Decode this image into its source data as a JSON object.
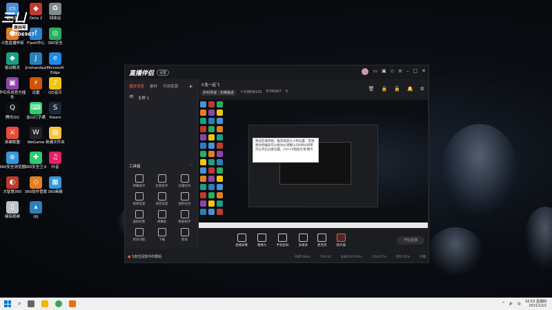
{
  "overlay_logo": {
    "text": "三ㄩ",
    "sub": "房间号",
    "number": "8706967"
  },
  "desktop_icons": [
    {
      "label": "此电脑",
      "color": "#4a90d9",
      "glyph": "▭"
    },
    {
      "label": "Dota 2",
      "color": "#c0392b",
      "glyph": "◆"
    },
    {
      "label": "回收站",
      "color": "#7f8c8d",
      "glyph": "♻"
    },
    {
      "label": "斗鱼直播伴侣",
      "color": "#e67e22",
      "glyph": "●"
    },
    {
      "label": "Flash中心",
      "color": "#2c82c9",
      "glyph": "f"
    },
    {
      "label": "360安全",
      "color": "#27ae60",
      "glyph": "◎"
    },
    {
      "label": "驱动精灵",
      "color": "#16a085",
      "glyph": "◆"
    },
    {
      "label": "jinshandazi",
      "color": "#2980b9",
      "glyph": "J"
    },
    {
      "label": "Microsoft Edge",
      "color": "#1e88e5",
      "glyph": "e"
    },
    {
      "label": "炉石传说官方插件",
      "color": "#8e44ad",
      "glyph": "▣"
    },
    {
      "label": "迅雷",
      "color": "#d35400",
      "glyph": "⚡"
    },
    {
      "label": "QQ音乐",
      "color": "#f1c40f",
      "glyph": "♪"
    },
    {
      "label": "腾讯QQ",
      "color": "#111111",
      "glyph": "Q"
    },
    {
      "label": "金山打字通",
      "color": "#2ecc71",
      "glyph": "⌨"
    },
    {
      "label": "Steam",
      "color": "#1b2838",
      "glyph": "S"
    },
    {
      "label": "英雄联盟",
      "color": "#e74c3c",
      "glyph": "⚔"
    },
    {
      "label": "WeGame",
      "color": "#222222",
      "glyph": "W"
    },
    {
      "label": "新建文件夹",
      "color": "#f5c542",
      "glyph": "▤"
    },
    {
      "label": "360安全浏览器",
      "color": "#3498db",
      "glyph": "⊕"
    },
    {
      "label": "360安全卫士",
      "color": "#2ecc71",
      "glyph": "✚"
    },
    {
      "label": "抖音",
      "color": "#e91e63",
      "glyph": "♫"
    },
    {
      "label": "大智慧365",
      "color": "#c0392b",
      "glyph": "◐"
    },
    {
      "label": "360软件管家",
      "color": "#e67e22",
      "glyph": "◇"
    },
    {
      "label": "360画报",
      "color": "#3498db",
      "glyph": "▦"
    },
    {
      "label": "鼎铝视频",
      "color": "#bdc3c7",
      "glyph": "▯"
    },
    {
      "label": "tjtj",
      "color": "#2980b9",
      "glyph": "▴"
    }
  ],
  "app": {
    "brand": "直播伴侣",
    "badge": "设置",
    "left_tabs": [
      "播放场景",
      "素材",
      "可用资源"
    ],
    "active_tab": "播放场景",
    "add": "+",
    "scene": {
      "eye": "👁",
      "name": "全屏 1"
    },
    "tools_title": "工具箱",
    "tools_more": "⋯",
    "tools": [
      {
        "label": "弹幕助手"
      },
      {
        "label": "房管助手"
      },
      {
        "label": "主播任务"
      },
      {
        "label": "视频连麦"
      },
      {
        "label": "语音连麦"
      },
      {
        "label": "福利任务"
      },
      {
        "label": "虚拟形象"
      },
      {
        "label": "弹幕板"
      },
      {
        "label": "数据助手"
      },
      {
        "label": "更多功能"
      },
      {
        "label": "下载"
      },
      {
        "label": "帮助"
      }
    ],
    "notice": "S连击回放中的模组",
    "center_title": "斗鱼一起飞",
    "room_chip": "炉石传说 · 天梯速进",
    "room_info": [
      "十分钟Q6150",
      "8706967",
      "0"
    ],
    "toolbar_icons": [
      "🗑",
      "🔒",
      "🔓",
      "🔔",
      "⚙"
    ],
    "tooltip": "预览区域预留，推荐底座大小和位置，若视频比例偏高可以拖动以调整以5比例分辨率可以开启分屏位置，Ctrl+V粘贴文本/图片",
    "controls": [
      {
        "label": "直播录像",
        "red": false
      },
      {
        "label": "摄像头",
        "red": false
      },
      {
        "label": "手机投屏",
        "red": false
      },
      {
        "label": "多媒体",
        "red": false
      },
      {
        "label": "麦克风",
        "red": false
      },
      {
        "label": "扬声器",
        "red": true
      }
    ],
    "start_button": "开始直播",
    "status": [
      "码率:0kb/s",
      "FPS:30",
      "丢帧:0(0.00%)",
      "CPU:27%",
      "内存:55%",
      "开播"
    ]
  },
  "taskbar": {
    "time": "16:53 星期四",
    "date": "2021/12/2",
    "tray": [
      "^",
      "🔊",
      "中"
    ]
  }
}
